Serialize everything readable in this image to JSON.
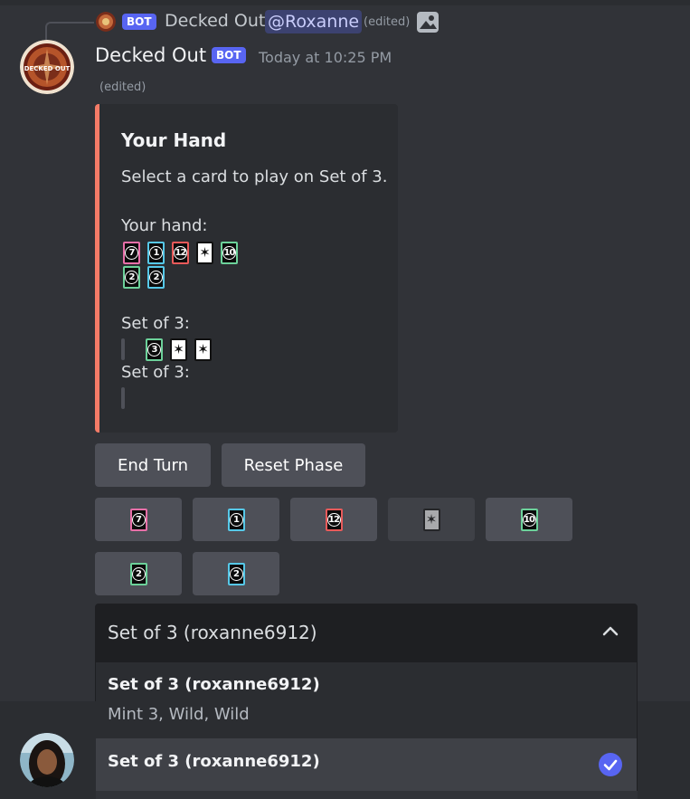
{
  "reply": {
    "bot_tag": "BOT",
    "name": "Decked Out",
    "mention": "@Roxanne",
    "edited": "(edited)",
    "icon": "image-icon"
  },
  "message": {
    "author": "Decked Out",
    "bot_tag": "BOT",
    "timestamp": "Today at 10:25 PM",
    "edited": "(edited)",
    "avatar_icon": "decked-out-avatar",
    "avatar_text": "DECKED OUT"
  },
  "embed": {
    "accent": "#f47b67",
    "title": "Your Hand",
    "description": "Select a card to play on Set of 3.",
    "hand_label": "Your hand:",
    "hand_row1": [
      {
        "value": "7",
        "color": "#e86fa8",
        "kind": "number"
      },
      {
        "value": "1",
        "color": "#56c8e8",
        "kind": "number"
      },
      {
        "value": "12",
        "color": "#e85a5a",
        "kind": "number"
      },
      {
        "value": "",
        "color": "#ffffff",
        "kind": "wild"
      },
      {
        "value": "10",
        "color": "#6cd19a",
        "kind": "number"
      }
    ],
    "hand_row2": [
      {
        "value": "2",
        "color": "#6cd19a",
        "kind": "number"
      },
      {
        "value": "2",
        "color": "#56c8e8",
        "kind": "number"
      }
    ],
    "set1_label": "Set of 3:",
    "set1_cards": [
      {
        "value": "3",
        "color": "#6cd19a",
        "kind": "number"
      },
      {
        "value": "",
        "color": "#ffffff",
        "kind": "wild"
      },
      {
        "value": "",
        "color": "#ffffff",
        "kind": "wild"
      }
    ],
    "set2_label": "Set of 3:"
  },
  "buttons": {
    "end_turn": "End Turn",
    "reset_phase": "Reset Phase"
  },
  "card_buttons": [
    {
      "value": "7",
      "color": "#e86fa8",
      "kind": "number",
      "disabled": false
    },
    {
      "value": "1",
      "color": "#56c8e8",
      "kind": "number",
      "disabled": false
    },
    {
      "value": "12",
      "color": "#e85a5a",
      "kind": "number",
      "disabled": false
    },
    {
      "value": "",
      "color": "#ffffff",
      "kind": "wild",
      "disabled": true
    },
    {
      "value": "10",
      "color": "#6cd19a",
      "kind": "number",
      "disabled": false
    },
    {
      "value": "2",
      "color": "#6cd19a",
      "kind": "number",
      "disabled": false
    },
    {
      "value": "2",
      "color": "#56c8e8",
      "kind": "number",
      "disabled": false
    }
  ],
  "select": {
    "value": "Set of 3 (roxanne6912)",
    "options": [
      {
        "label": "Set of 3 (roxanne6912)",
        "description": "Mint 3, Wild, Wild",
        "selected": false
      },
      {
        "label": "Set of 3 (roxanne6912)",
        "description": "",
        "selected": true
      }
    ]
  },
  "colors": {
    "background": "#313338",
    "blurple": "#5865f2",
    "button": "#4e5058"
  }
}
